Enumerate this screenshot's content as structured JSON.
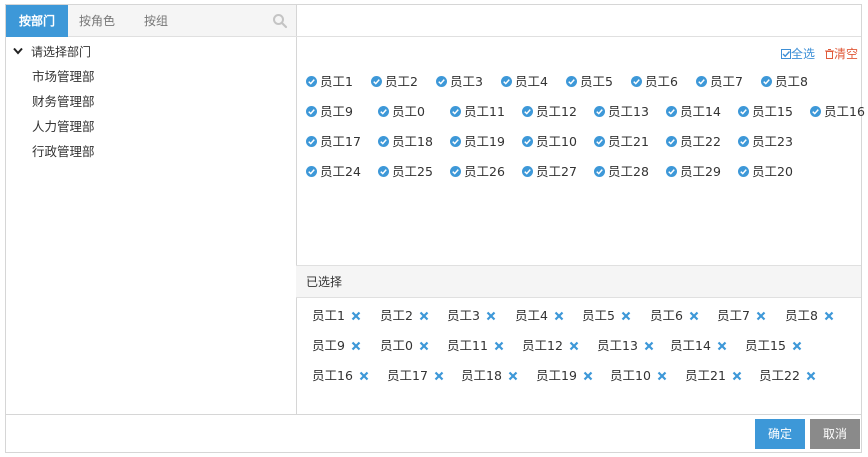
{
  "tabs": [
    "按部门",
    "按角色",
    "按组"
  ],
  "tree": {
    "root_label": "请选择部门",
    "departments": [
      "市场管理部",
      "财务管理部",
      "人力管理部",
      "行政管理部"
    ]
  },
  "actions": {
    "select_all": "全选",
    "clear": "清空"
  },
  "employees": [
    [
      "员工1",
      "员工2",
      "员工3",
      "员工4",
      "员工5",
      "员工6",
      "员工7",
      "员工8"
    ],
    [
      "员工9",
      "员工0",
      "员工11",
      "员工12",
      "员工13",
      "员工14",
      "员工15",
      "员工16"
    ],
    [
      "员工17",
      "员工18",
      "员工19",
      "员工10",
      "员工21",
      "员工22",
      "员工23"
    ],
    [
      "员工24",
      "员工25",
      "员工26",
      "员工27",
      "员工28",
      "员工29",
      "员工20"
    ]
  ],
  "selected_label": "已选择",
  "selected": [
    [
      "员工1",
      "员工2",
      "员工3",
      "员工4",
      "员工5",
      "员工6",
      "员工7",
      "员工8"
    ],
    [
      "员工9",
      "员工0",
      "员工11",
      "员工12",
      "员工13",
      "员工14",
      "员工15"
    ],
    [
      "员工16",
      "员工17",
      "员工18",
      "员工19",
      "员工10",
      "员工21",
      "员工22"
    ]
  ],
  "footer": {
    "ok": "确定",
    "cancel": "取消"
  },
  "colors": {
    "accent": "#3d98d8",
    "clear": "#e05a3a",
    "cancel_bg": "#8a8a8a"
  }
}
